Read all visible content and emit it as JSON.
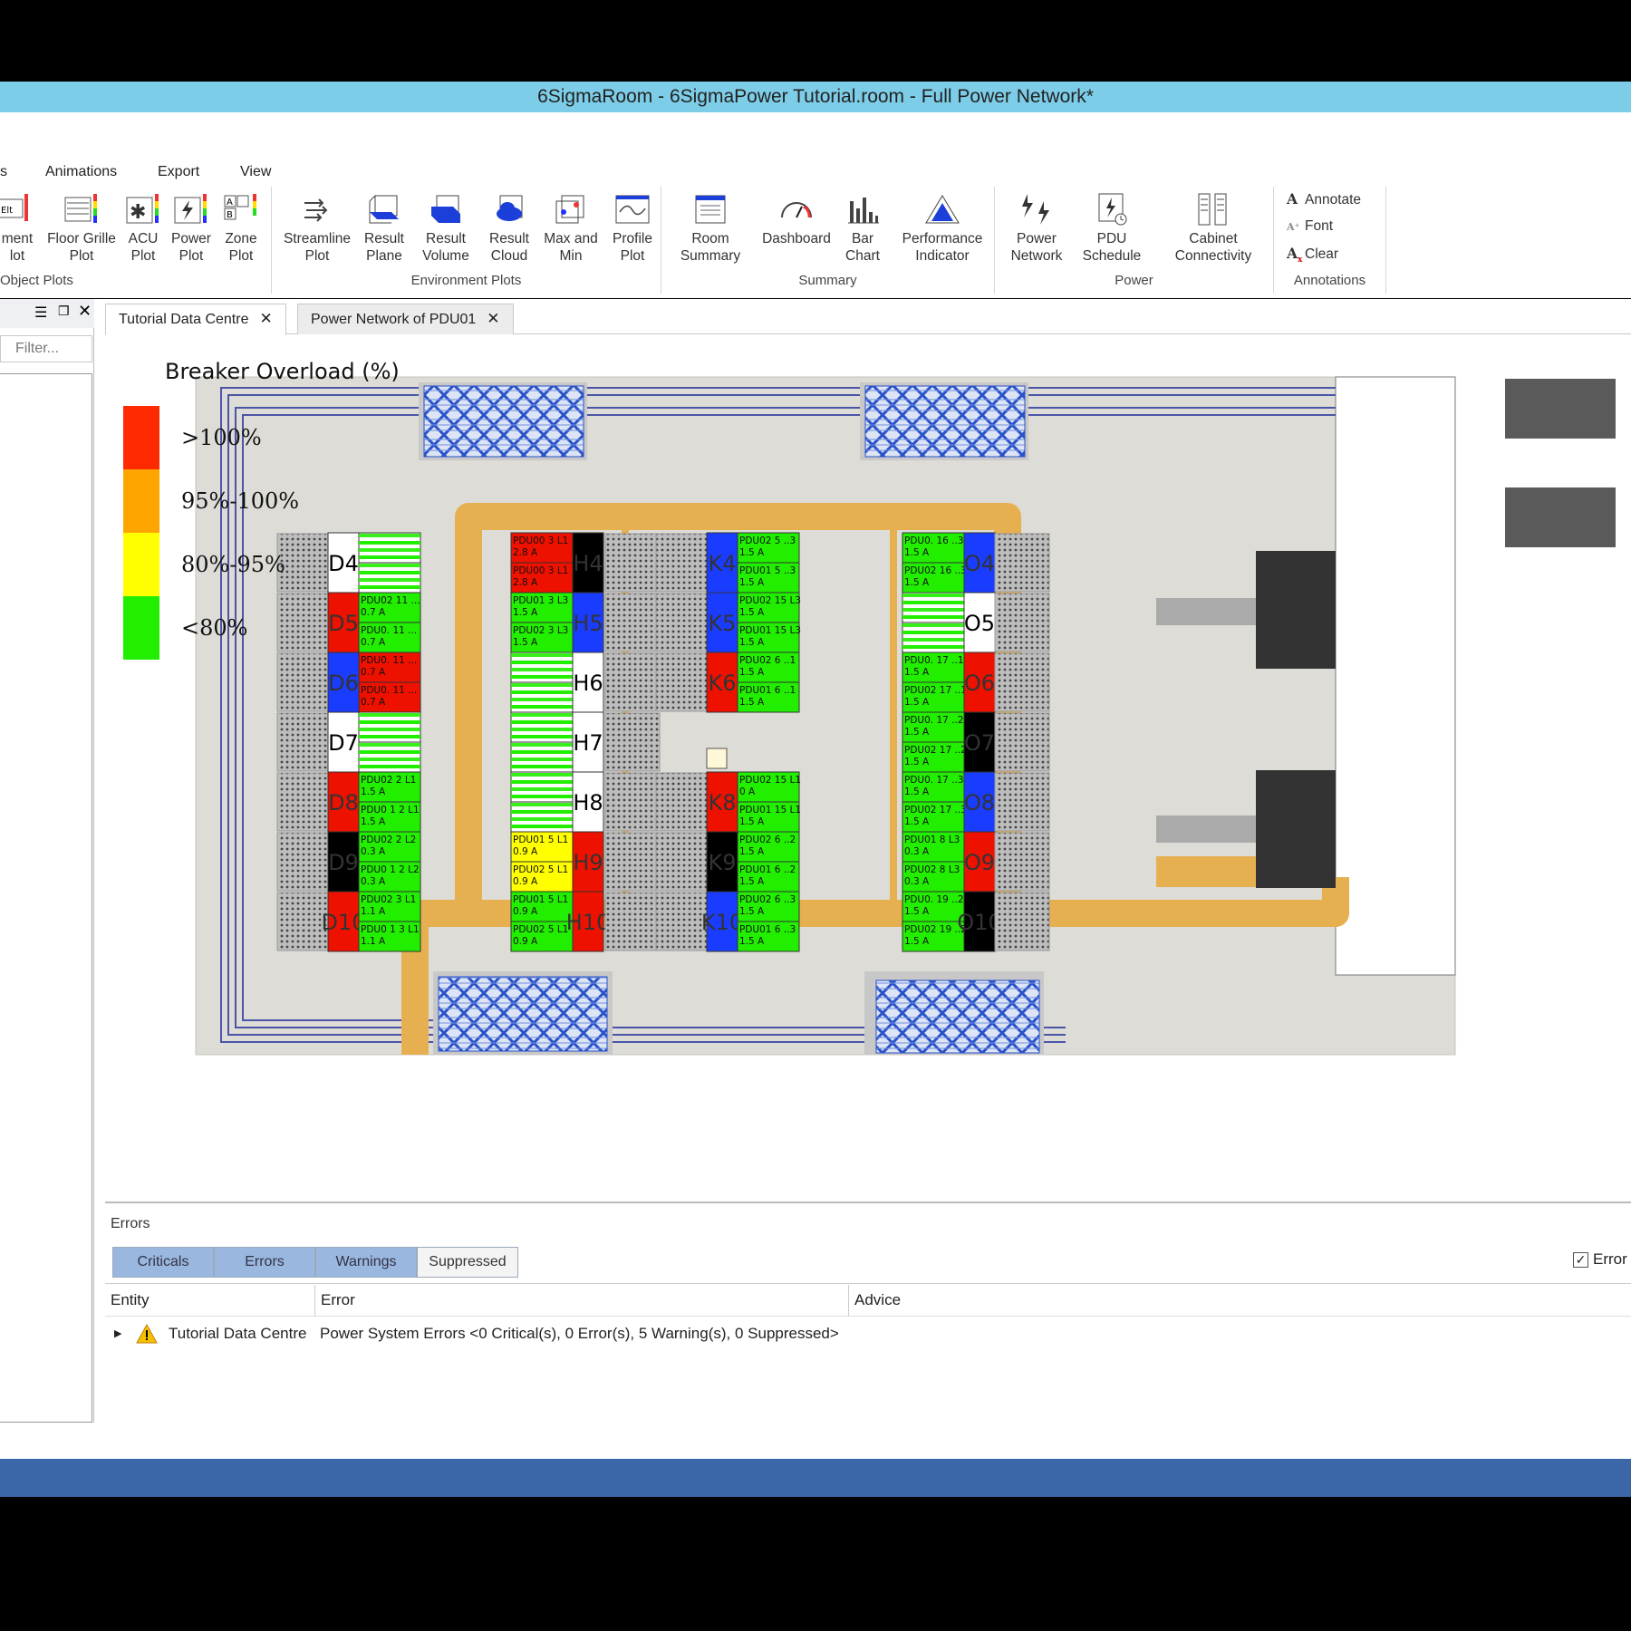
{
  "window": {
    "title": "6SigmaRoom - 6SigmaPower Tutorial.room - Full Power Network*"
  },
  "ribbon": {
    "tabs": [
      "s",
      "Animations",
      "Export",
      "View"
    ],
    "groups": {
      "object_plots": {
        "title": "Object Plots",
        "buttons": [
          "ment\nlot",
          "Floor Grille\nPlot",
          "ACU\nPlot",
          "Power\nPlot",
          "Zone\nPlot"
        ]
      },
      "environment_plots": {
        "title": "Environment Plots",
        "buttons": [
          "Streamline\nPlot",
          "Result\nPlane",
          "Result\nVolume",
          "Result\nCloud",
          "Max and\nMin",
          "Profile\nPlot"
        ]
      },
      "summary": {
        "title": "Summary",
        "buttons": [
          "Room\nSummary",
          "Dashboard",
          "Bar\nChart",
          "Performance\nIndicator"
        ]
      },
      "power": {
        "title": "Power",
        "buttons": [
          "Power\nNetwork",
          "PDU\nSchedule",
          "Cabinet\nConnectivity"
        ]
      },
      "annotations": {
        "title": "Annotations",
        "items": [
          "Annotate",
          "Font",
          "Clear"
        ]
      }
    }
  },
  "left_panel": {
    "filter_placeholder": "Filter..."
  },
  "doc_tabs": [
    {
      "label": "Tutorial Data Centre"
    },
    {
      "label": "Power Network of PDU01"
    }
  ],
  "legend": {
    "title": "Breaker Overload (%)",
    "items": [
      {
        "label": ">100%",
        "color": "#ff2a00"
      },
      {
        "label": "95%-100%",
        "color": "#ffa500"
      },
      {
        "label": "80%-95%",
        "color": "#ffff00"
      },
      {
        "label": "<80%",
        "color": "#22ee00"
      }
    ]
  },
  "cabinets": {
    "row_d": [
      {
        "label": "D4",
        "color": "#ffffff"
      },
      {
        "label": "D5",
        "color": "#ee1100"
      },
      {
        "label": "D6",
        "color": "#1a3cff"
      },
      {
        "label": "D7",
        "color": "#ffffff"
      },
      {
        "label": "D8",
        "color": "#ee1100"
      },
      {
        "label": "D9",
        "color": "#000000"
      },
      {
        "label": "D10",
        "color": "#ee1100"
      }
    ],
    "row_h": [
      {
        "label": "H4",
        "color": "#000000"
      },
      {
        "label": "H5",
        "color": "#1a3cff"
      },
      {
        "label": "H6",
        "color": "#ffffff"
      },
      {
        "label": "H7",
        "color": "#ffffff"
      },
      {
        "label": "H8",
        "color": "#ffffff"
      },
      {
        "label": "H9",
        "color": "#ee1100"
      },
      {
        "label": "H10",
        "color": "#ee1100"
      }
    ],
    "row_k": [
      {
        "label": "K4",
        "color": "#1a3cff"
      },
      {
        "label": "K5",
        "color": "#1a3cff"
      },
      {
        "label": "K6",
        "color": "#ee1100"
      },
      {
        "label": "",
        "color": "#ffffff"
      },
      {
        "label": "K8",
        "color": "#ee1100"
      },
      {
        "label": "K9",
        "color": "#000000"
      },
      {
        "label": "K10",
        "color": "#1a3cff"
      }
    ],
    "row_o": [
      {
        "label": "O4",
        "color": "#1a3cff"
      },
      {
        "label": "O5",
        "color": "#ffffff"
      },
      {
        "label": "O6",
        "color": "#ee1100"
      },
      {
        "label": "O7",
        "color": "#000000"
      },
      {
        "label": "O8",
        "color": "#1a3cff"
      },
      {
        "label": "O9",
        "color": "#ee1100"
      },
      {
        "label": "O10",
        "color": "#000000"
      }
    ]
  },
  "pdu_strips": {
    "d": [
      [
        "striped",
        "striped"
      ],
      [
        "PDU02 11 ...\n0.7 A",
        "PDU0. 11 ...\n0.7 A"
      ],
      [
        "PDU0. 11 ...\n0.7 A",
        "PDU0. 11 ...\n0.7 A"
      ],
      [
        "striped",
        "striped"
      ],
      [
        "PDU02 2 L1\n1.5 A",
        "PDU0 1 2 L1\n1.5 A"
      ],
      [
        "PDU02 2 L2\n0.3 A",
        "PDU0 1 2 L2\n0.3 A"
      ],
      [
        "PDU02 3 L1\n1.1 A",
        "PDU0 1 3 L1\n1.1 A"
      ]
    ],
    "h": [
      [
        "PDU00 3 L1\n2.8 A",
        "PDU00 3 L1\n2.8 A"
      ],
      [
        "PDU01 3 L3\n1.5 A",
        "PDU02 3 L3\n1.5 A"
      ],
      [
        "striped",
        "striped"
      ],
      [
        "striped",
        "striped"
      ],
      [
        "striped",
        "striped"
      ],
      [
        "PDU01 5 L1\n0.9 A",
        "PDU02 5 L1\n0.9 A"
      ],
      [
        "PDU01 5 L1\n0.9 A",
        "PDU02 5 L1\n0.9 A"
      ]
    ],
    "k": [
      [
        "PDU02 5 ..3\n1.5 A",
        "PDU01 5 ..3\n1.5 A"
      ],
      [
        "PDU02 15 L3\n1.5 A",
        "PDU01 15 L3\n1.5 A"
      ],
      [
        "PDU02 6 ..1\n1.5 A",
        "PDU01 6 ..1\n1.5 A"
      ],
      [
        "",
        ""
      ],
      [
        "PDU02 15 L1\n0 A",
        "PDU01 15 L1\n1.5 A"
      ],
      [
        "PDU02 6 ..2\n1.5 A",
        "PDU01 6 ..2\n1.5 A"
      ],
      [
        "PDU02 6 ..3\n1.5 A",
        "PDU01 6 ..3\n1.5 A"
      ]
    ],
    "o": [
      [
        "PDU0. 16 ..3\n1.5 A",
        "PDU02 16 ..3\n1.5 A"
      ],
      [
        "striped",
        "striped"
      ],
      [
        "PDU0. 17 ..1\n1.5 A",
        "PDU02 17 ..1\n1.5 A"
      ],
      [
        "PDU0. 17 ..2\n1.5 A",
        "PDU02 17 ..2\n1.5 A"
      ],
      [
        "PDU0. 17 ..3\n1.5 A",
        "PDU02 17 ..3\n1.5 A"
      ],
      [
        "PDU01 8 L3\n0.3 A",
        "PDU02 8 L3\n0.3 A"
      ],
      [
        "PDU0. 19 ..2\n1.5 A",
        "PDU02 19 ..2\n1.5 A"
      ]
    ]
  },
  "errors_panel": {
    "title": "Errors",
    "tabs": [
      "Criticals",
      "Errors",
      "Warnings",
      "Suppressed"
    ],
    "checkbox_label": "Error",
    "columns": [
      "Entity",
      "Error",
      "Advice"
    ],
    "rows": [
      {
        "entity": "Tutorial Data Centre",
        "error": "Power System Errors <0 Critical(s), 0 Error(s), 5 Warning(s), 0 Suppressed>",
        "advice": ""
      }
    ]
  }
}
